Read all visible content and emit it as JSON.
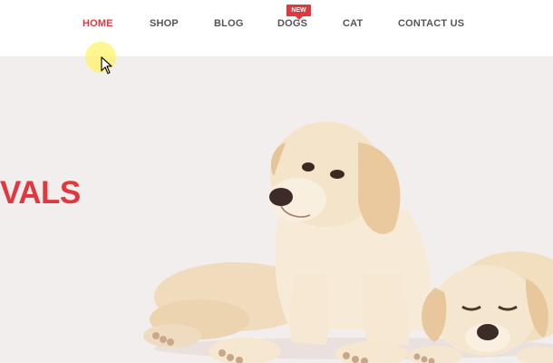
{
  "nav": {
    "items": [
      {
        "label": "HOME"
      },
      {
        "label": "SHOP"
      },
      {
        "label": "BLOG"
      },
      {
        "label": "DOGS"
      },
      {
        "label": "CAT"
      },
      {
        "label": "CONTACT US"
      }
    ],
    "active_item": "HOME",
    "badge": "NEW"
  },
  "hero": {
    "heading_fragment": "VALS"
  },
  "colors": {
    "accent": "#e0383e",
    "nav_text": "#555555",
    "hero_background": "#f3eeee"
  },
  "icons": [
    "mouse-pointer-icon"
  ]
}
